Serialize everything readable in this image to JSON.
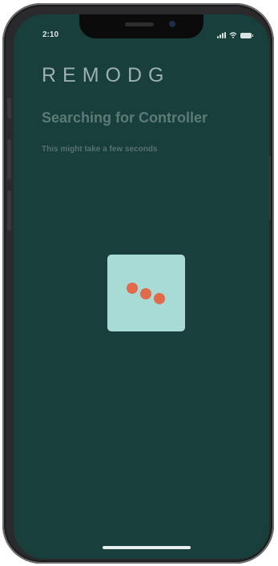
{
  "status_bar": {
    "time": "2:10"
  },
  "app": {
    "logo_text": "REMODG",
    "title": "Searching for Controller",
    "subtitle": "This might take a few seconds"
  },
  "loader": {
    "dot_count": 3,
    "dot_color": "#e06a4a",
    "card_color": "#a8dbd6"
  },
  "colors": {
    "screen_background": "#183f3c",
    "title_text": "#5d7a76",
    "logo_text": "#9cb0ad"
  },
  "icons": {
    "signal": "signal-icon",
    "wifi": "wifi-icon",
    "battery": "battery-icon"
  }
}
